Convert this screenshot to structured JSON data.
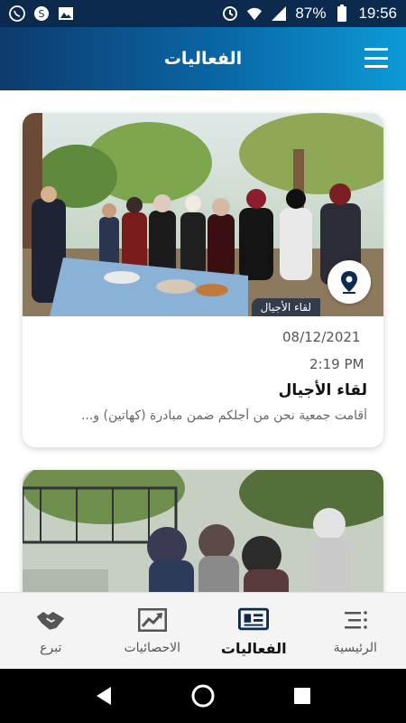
{
  "status_bar": {
    "battery": "87%",
    "time": "19:56",
    "left_icons": [
      "whatsapp-icon",
      "skype-icon",
      "gallery-icon"
    ],
    "right_icons": [
      "sync-icon",
      "wifi-icon",
      "signal-icon",
      "battery-icon"
    ]
  },
  "app_bar": {
    "title": "الفعاليات",
    "menu_icon": "menu-icon"
  },
  "events": [
    {
      "date": "08/12/2021",
      "time": "2:19 PM",
      "title": "لقاء الأجيال",
      "excerpt": "أقامت جمعية نحن من أجلكم ضمن مبادرة (كهاتين) و...",
      "image_banner": "لقاء الأجيال",
      "location_icon": "location-pin-icon"
    },
    {
      "image_only": true
    }
  ],
  "bottom_nav": {
    "items": [
      {
        "label": "الرئيسية",
        "icon": "home-list-icon",
        "active": false
      },
      {
        "label": "الفعاليات",
        "icon": "newspaper-icon",
        "active": true
      },
      {
        "label": "الاحصائيات",
        "icon": "chart-icon",
        "active": false
      },
      {
        "label": "تبرع",
        "icon": "handshake-icon",
        "active": false
      }
    ]
  },
  "colors": {
    "status_bar": "#0b2a4d",
    "app_bar_start": "#0d3b6e",
    "app_bar_end": "#0c9ad6",
    "active_nav": "#0b2a4d"
  },
  "system_nav": [
    "back-icon",
    "home-icon",
    "recents-icon"
  ]
}
